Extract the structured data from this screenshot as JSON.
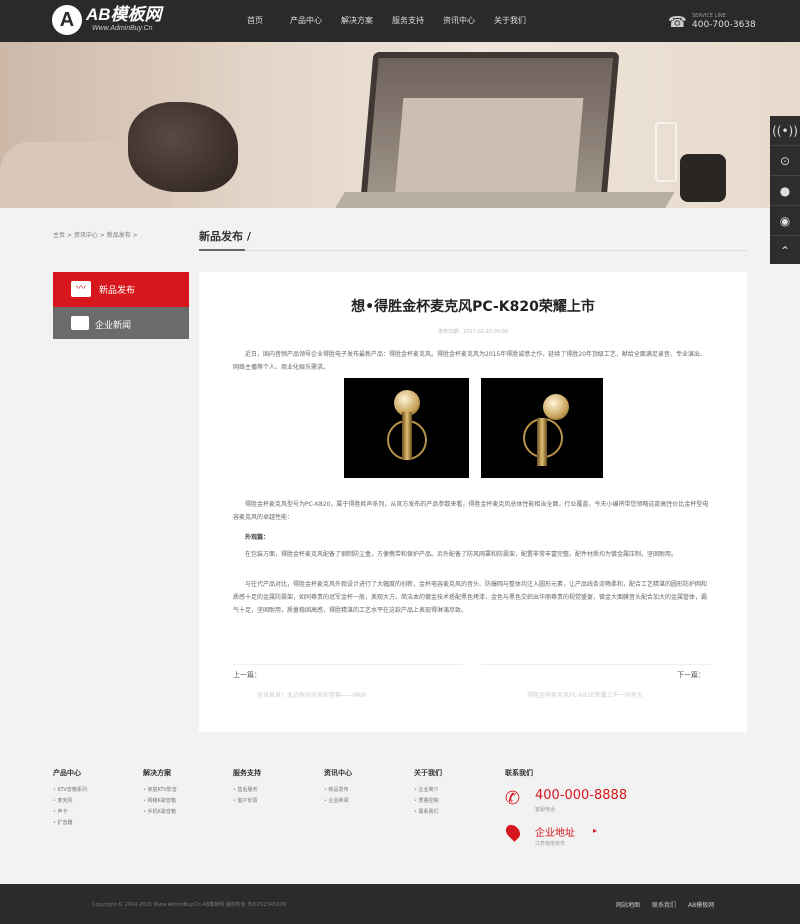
{
  "header": {
    "logo_mark": "A",
    "logo_text": "AB模板网",
    "logo_url": "Www.AdminBuy.Cn",
    "nav": [
      "首页",
      "产品中心",
      "解决方案",
      "服务支持",
      "资讯中心",
      "关于我们"
    ],
    "phone_label": "SERVICE LINE",
    "phone_number": "400-700-3638"
  },
  "breadcrumb": [
    "主页",
    "资讯中心",
    "新品发布"
  ],
  "section_title": "新品发布",
  "left_menu": [
    {
      "label": "新品发布",
      "active": true
    },
    {
      "label": "企业新闻",
      "active": false
    }
  ],
  "article": {
    "title": "想•得胜金杯麦克风PC-K820荣耀上市",
    "meta": "发布日期：2017-02-20 00:00",
    "p1": "近日，国内音频产品领导企业得胜电子发布最新产品：得胜金杯麦克风。得胜金杯麦克风为2015年得胜诚意之作，延续了得胜20年顶级工艺，献给全面满足录音、专业演出、网络主播等个人、商业化娱乐需求。",
    "p2": "得胜金杯麦克风型号为PC-K820，属于得胜耗声系列，从官方发布的产品参数来看，得胜金杯麦克风总体性能相当全面，行业覆盖，今天小编将带您领略这款高性价比金杯型电容麦克风的卓越性能：",
    "p3": "外观篇：",
    "p4": "在包装方面，得胜金杯麦克风配备了钢制防尘盒，方便携带和保护产品。另外配备了防风网罩和防震架，配置非常丰富完整。配件材质均为镀金属压制，坚固耐用。",
    "p5": "与往代产品对比，得胜金杯麦克风外观设计进行了大幅度的创新，金杯电容麦克风的音头、防爆网与整体均注入圆形元素，让产品线条流畅柔和，配合工艺精湛的圆形防护网和质感十足的金属防震架，如同尊贵的冠军金杯一般，美观大方。简洁本的镀金技术搭配黑色烤漆，金色与黑色交织出华丽尊贵的视觉盛宴，镀金大面膜音头配合加大的金属管体，霸气十足，坚固耐用，质量稳固高感，得胜精湛的工艺水平在这款产品上表现得淋漓尽致。",
    "prev_label": "上一篇：",
    "next_label": "下一篇：",
    "prev_title": "全球首发！无边框时尚多彩音箱——M68",
    "next_title": "得胜金杯麦克风PC-K820荣耀上市一问答大"
  },
  "footer": {
    "columns": [
      {
        "title": "产品中心",
        "items": [
          "KTV音箱系列",
          "麦克风",
          "声卡",
          "扩音器"
        ]
      },
      {
        "title": "解决方案",
        "items": [
          "家庭KTV影音",
          "网络K歌音箱",
          "手机K歌音箱"
        ]
      },
      {
        "title": "服务支持",
        "items": [
          "售后服务",
          "客户反馈"
        ]
      },
      {
        "title": "资讯中心",
        "items": [
          "新品发布",
          "企业新闻"
        ]
      },
      {
        "title": "关于我们",
        "items": [
          "企业简介",
          "质量控制",
          "联系我们"
        ]
      }
    ],
    "contact_title": "联系我们",
    "tel": "400-000-8888",
    "tel_sub": "客服电话",
    "addr_title": "企业地址",
    "addr_sub": "江苏省南京市",
    "copyright": "Copyright © 2004-2015 Www.AdminBuy.Cn AB模板网 版权所有 苏ICP12345678",
    "bottom_links": [
      "网站地图",
      "联系我们",
      "AB模板网"
    ]
  },
  "colors": {
    "accent": "#d6171d",
    "header_bg": "#2a2a2a",
    "menu_gray": "#6b6b6b"
  }
}
